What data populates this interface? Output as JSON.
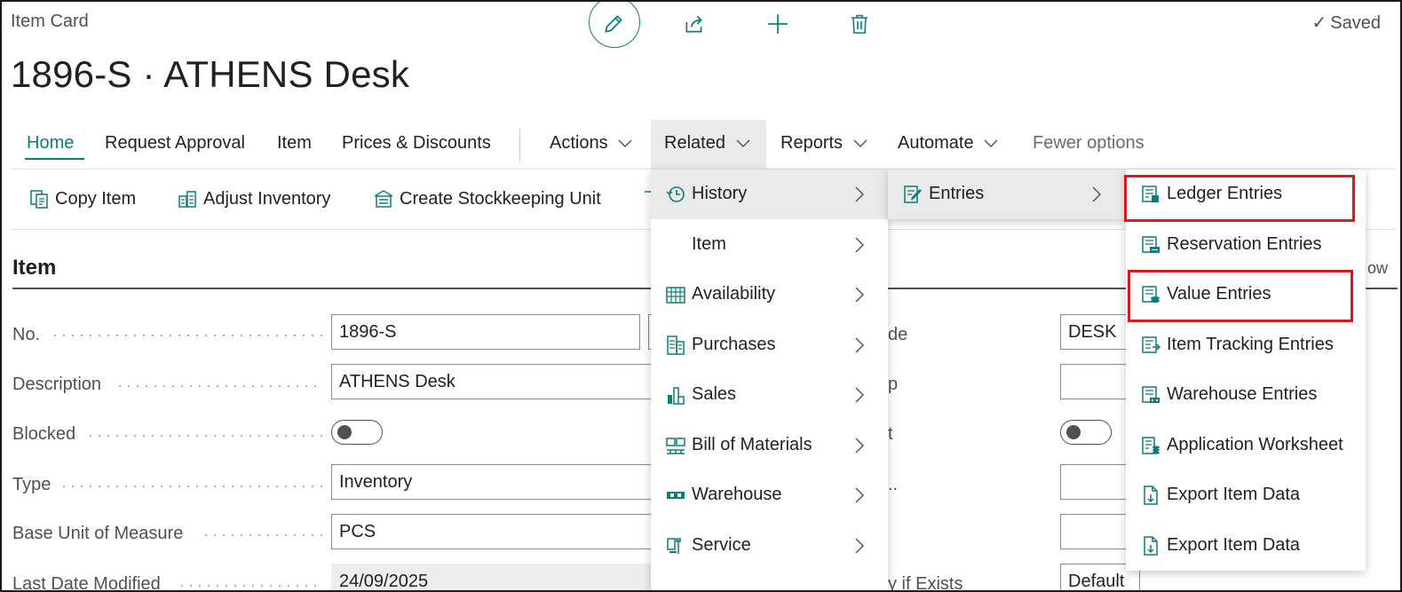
{
  "header": {
    "kicker": "Item Card",
    "saved": "Saved",
    "title": "1896-S · ATHENS Desk"
  },
  "toolbar_icons": [
    "pencil-icon",
    "share-icon",
    "plus-icon",
    "trash-icon"
  ],
  "nav": {
    "home": "Home",
    "request_approval": "Request Approval",
    "item": "Item",
    "prices": "Prices & Discounts",
    "actions": "Actions",
    "related": "Related",
    "reports": "Reports",
    "automate": "Automate",
    "fewer": "Fewer options"
  },
  "actionbar": {
    "copy_item": "Copy Item",
    "adjust_inventory": "Adjust Inventory",
    "create_sku": "Create Stockkeeping Unit"
  },
  "section": {
    "title": "Item",
    "right_fragment": "ow"
  },
  "fields": {
    "no": {
      "label": "No.",
      "value": "1896-S"
    },
    "description": {
      "label": "Description",
      "value": "ATHENS Desk"
    },
    "blocked": {
      "label": "Blocked"
    },
    "type": {
      "label": "Type",
      "value": "Inventory"
    },
    "base_uom": {
      "label": "Base Unit of Measure",
      "value": "PCS"
    },
    "last_modified": {
      "label": "Last Date Modified",
      "value": "24/09/2025"
    }
  },
  "right_fields": {
    "frag1": "de",
    "value1": "DESK",
    "frag2": "p",
    "frag3": "t",
    "frag4": "..",
    "frag6": "y if Exists",
    "value6": "Default"
  },
  "related_menu": [
    {
      "label": "History",
      "icon": "history-icon",
      "active": true
    },
    {
      "label": "Item",
      "icon": ""
    },
    {
      "label": "Availability",
      "icon": "availability-icon"
    },
    {
      "label": "Purchases",
      "icon": "purchases-icon"
    },
    {
      "label": "Sales",
      "icon": "sales-icon"
    },
    {
      "label": "Bill of Materials",
      "icon": "bill-of-materials-icon"
    },
    {
      "label": "Warehouse",
      "icon": "warehouse-icon"
    },
    {
      "label": "Service",
      "icon": "service-icon"
    }
  ],
  "history_menu": [
    {
      "label": "Entries",
      "icon": "entries-icon",
      "active": true
    }
  ],
  "entries_menu": [
    {
      "label": "Ledger Entries",
      "icon": "ledger-entries-icon",
      "highlighted": true
    },
    {
      "label": "Reservation Entries",
      "icon": "reservation-entries-icon"
    },
    {
      "label": "Value Entries",
      "icon": "value-entries-icon",
      "highlighted": true
    },
    {
      "label": "Item Tracking Entries",
      "icon": "item-tracking-entries-icon"
    },
    {
      "label": "Warehouse Entries",
      "icon": "warehouse-entries-icon"
    },
    {
      "label": "Application Worksheet",
      "icon": "application-worksheet-icon"
    },
    {
      "label": "Export Item Data",
      "icon": "export-item-data-icon"
    },
    {
      "label": "Export Item Data",
      "icon": "export-item-data-icon"
    }
  ],
  "colors": {
    "accent": "#0f7b7b",
    "highlight": "#d71920"
  }
}
